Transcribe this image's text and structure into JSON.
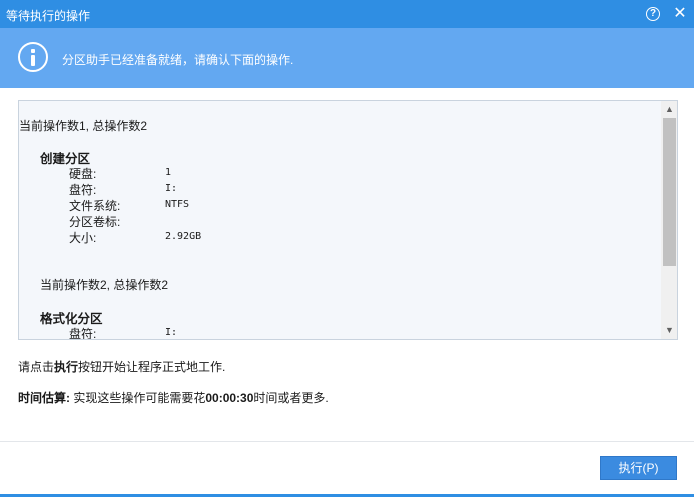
{
  "window": {
    "title": "等待执行的操作",
    "help_icon_text": "?",
    "close_icon_text": "✕"
  },
  "banner": {
    "message": "分区助手已经准备就绪，请确认下面的操作."
  },
  "operations": [
    {
      "header": "当前操作数1, 总操作数2",
      "name": "创建分区",
      "properties": [
        {
          "key": "硬盘:",
          "value": "1"
        },
        {
          "key": "盘符:",
          "value": "I:"
        },
        {
          "key": "文件系统:",
          "value": "NTFS"
        },
        {
          "key": "分区卷标:",
          "value": ""
        },
        {
          "key": "大小:",
          "value": "2.92GB"
        }
      ]
    },
    {
      "header": "当前操作数2, 总操作数2",
      "name": "格式化分区",
      "properties": [
        {
          "key": "盘符:",
          "value": "I:"
        }
      ]
    }
  ],
  "instruction": {
    "prefix": "请点击",
    "bold": "执行",
    "suffix": "按钮开始让程序正式地工作."
  },
  "estimate": {
    "label": "时间估算:",
    "text_before": " 实现这些操作可能需要花",
    "duration": "00:00:30",
    "text_after": "时间或者更多."
  },
  "buttons": {
    "execute_label": "执行(P)"
  },
  "colors": {
    "titlebar": "#2f8ee3",
    "banner": "#63a8f1",
    "button": "#3b8be0"
  }
}
